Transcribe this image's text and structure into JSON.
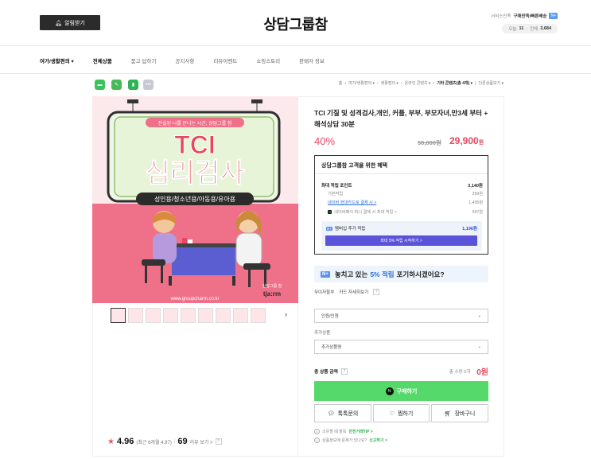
{
  "header": {
    "alarm_label": "알림받기",
    "logo": "상담그룹참",
    "service_grade_label": "서비스만족",
    "service_grade_value": "구매만족/빠른배송",
    "naverpay_badge": "N+",
    "visit_today_label": "오늘",
    "visit_today": "11",
    "visit_total_label": "전체",
    "visit_total": "3,684"
  },
  "nav": {
    "items": [
      "여가/생활편의 ▾",
      "전체상품",
      "묻고 답하기",
      "공지사항",
      "리뷰이벤트",
      "쇼핑스토리",
      "판매자 정보"
    ]
  },
  "breadcrumb": {
    "items": [
      "홈",
      "여가/생활편의 ▾",
      "생활편의 ▾",
      "온라인 콘텐츠 ▾"
    ],
    "current": "기타 콘텐츠(총 4개) ▾",
    "more": "다른상품보기 ▾"
  },
  "image": {
    "subtitle": "진실된 나를 만나는 시간, 상담그룹 참",
    "title_line1": "TCI",
    "title_line2": "심리검사",
    "audience": "성인용/청소년용/아동용/유아용",
    "brand_small": "상담그룹 참",
    "brand_logo": "tja:rm",
    "url": "www.groupcharm.co.kr"
  },
  "rating": {
    "score": "4.96",
    "recent": "(최근 6개월 4.97)",
    "reviews": "69",
    "reviews_label": "리뷰 보기 >"
  },
  "product": {
    "title": "TCI 기질 및 성격검사,개인, 커플, 부부, 부모자녀,만3세 부터 + 해석상담 30분",
    "discount": "40%",
    "original_price": "50,000원",
    "price": "29,900",
    "price_unit": "원"
  },
  "benefit": {
    "title": "상담그룹참 고객을 위한 혜택",
    "max_label": "최대 적립 포인트",
    "max_value": "3,140원",
    "rows": [
      {
        "label": "기본적립",
        "value": "299원"
      },
      {
        "label": "네이버 현대카드로 결제 시 >",
        "value": "1,495원"
      },
      {
        "label": "네이버페이 머니 결제 시 최대 적립 >",
        "value": "597원"
      }
    ],
    "membership_label": "멤버십 추가 적립",
    "membership_value": "1,196원",
    "membership_btn": "최대 5% 적립 시작하기 >"
  },
  "banner": {
    "text_prefix": "놓치고 있는",
    "highlight": "5% 적립",
    "text_suffix": "포기하시겠어요?"
  },
  "shipping": {
    "label": "무이자할부",
    "card": "카드 자세히보기"
  },
  "options": {
    "select1": "인원/인원",
    "extra_label": "추가상품",
    "select2": "추가상품명"
  },
  "total": {
    "label": "총 상품 금액",
    "qty": "총 수량 0개",
    "amount": "0원"
  },
  "buttons": {
    "buy": "구매하기",
    "npay": "N",
    "talk": "톡톡문의",
    "wish": "찜하기",
    "cart": "장바구니"
  },
  "notes": {
    "note1_text": "소유할 때 필독",
    "note1_link": "안전거래TIP >",
    "note2_text": "상품정보에 문제가 있나요?",
    "note2_link": "신고하기 >"
  },
  "colors": {
    "accent_red": "#e8475f",
    "buy_green": "#55d96a",
    "benefit_purple": "#5a52d9",
    "image_pink": "#ef7089",
    "image_green": "#e7f4d8"
  }
}
